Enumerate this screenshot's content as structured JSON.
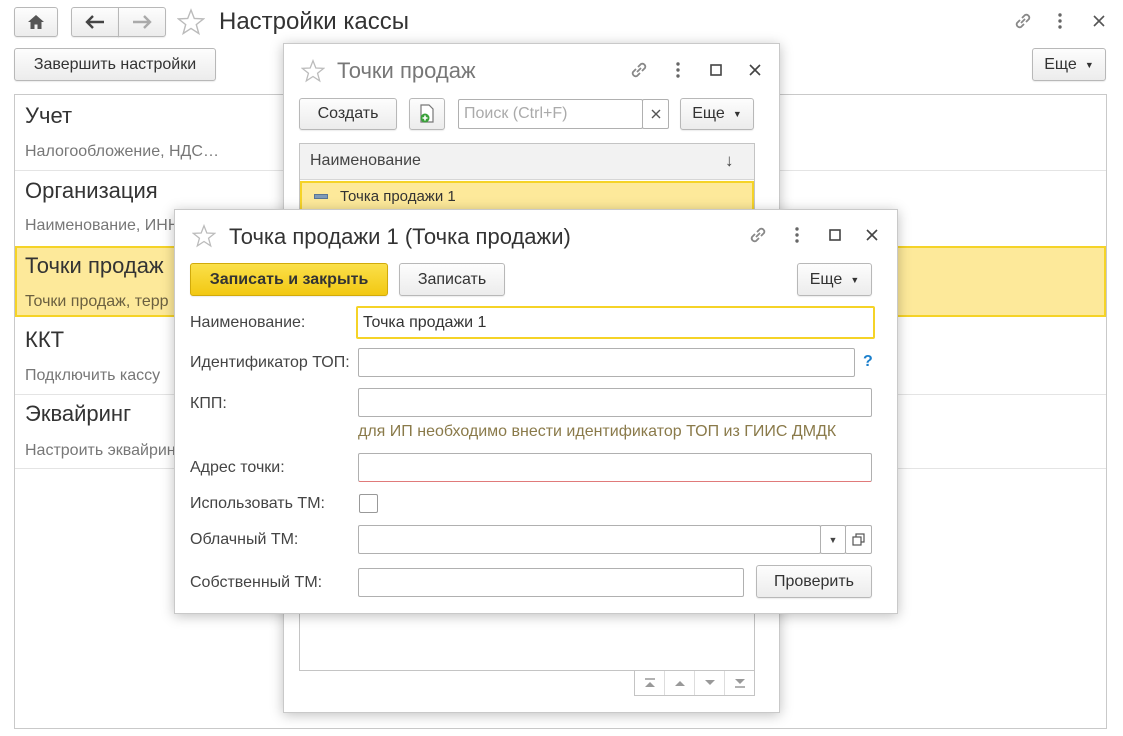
{
  "main": {
    "title": "Настройки кассы",
    "finish_button": "Завершить настройки",
    "more_button": "Еще",
    "sections": [
      {
        "title": "Учет",
        "subtitle": "Налогообложение, НДС…"
      },
      {
        "title": "Организация",
        "subtitle": "Наименование, ИНН"
      },
      {
        "title": "Точки продаж",
        "subtitle": "Точки продаж, терр"
      },
      {
        "title": "ККТ",
        "subtitle": "Подключить кассу"
      },
      {
        "title": "Эквайринг",
        "subtitle": "Настроить эквайрин"
      }
    ]
  },
  "list_window": {
    "title": "Точки продаж",
    "create_button": "Создать",
    "search_placeholder": "Поиск (Ctrl+F)",
    "more_button": "Еще",
    "column_header": "Наименование",
    "sort_indicator": "↓",
    "rows": [
      {
        "name": "Точка продажи 1"
      }
    ]
  },
  "form_window": {
    "title": "Точка продажи 1 (Точка продажи)",
    "save_close_button": "Записать и закрыть",
    "save_button": "Записать",
    "more_button": "Еще",
    "fields": {
      "name_label": "Наименование:",
      "name_value": "Точка продажи 1",
      "top_label": "Идентификатор ТОП:",
      "top_value": "",
      "help_mark": "?",
      "kpp_label": "КПП:",
      "kpp_value": "",
      "kpp_hint": "для ИП необходимо внести идентификатор ТОП из ГИИС ДМДК",
      "address_label": "Адрес точки:",
      "address_value": "",
      "use_tm_label": "Использовать ТМ:",
      "cloud_tm_label": "Облачный ТМ:",
      "cloud_tm_value": "",
      "own_tm_label": "Собственный ТМ:",
      "own_tm_value": "",
      "check_button": "Проверить"
    }
  },
  "colors": {
    "accent_yellow": "#f5d327",
    "highlight_row": "#fde99a",
    "hint_text": "#8a7a4a",
    "help_blue": "#1b7fcc"
  }
}
